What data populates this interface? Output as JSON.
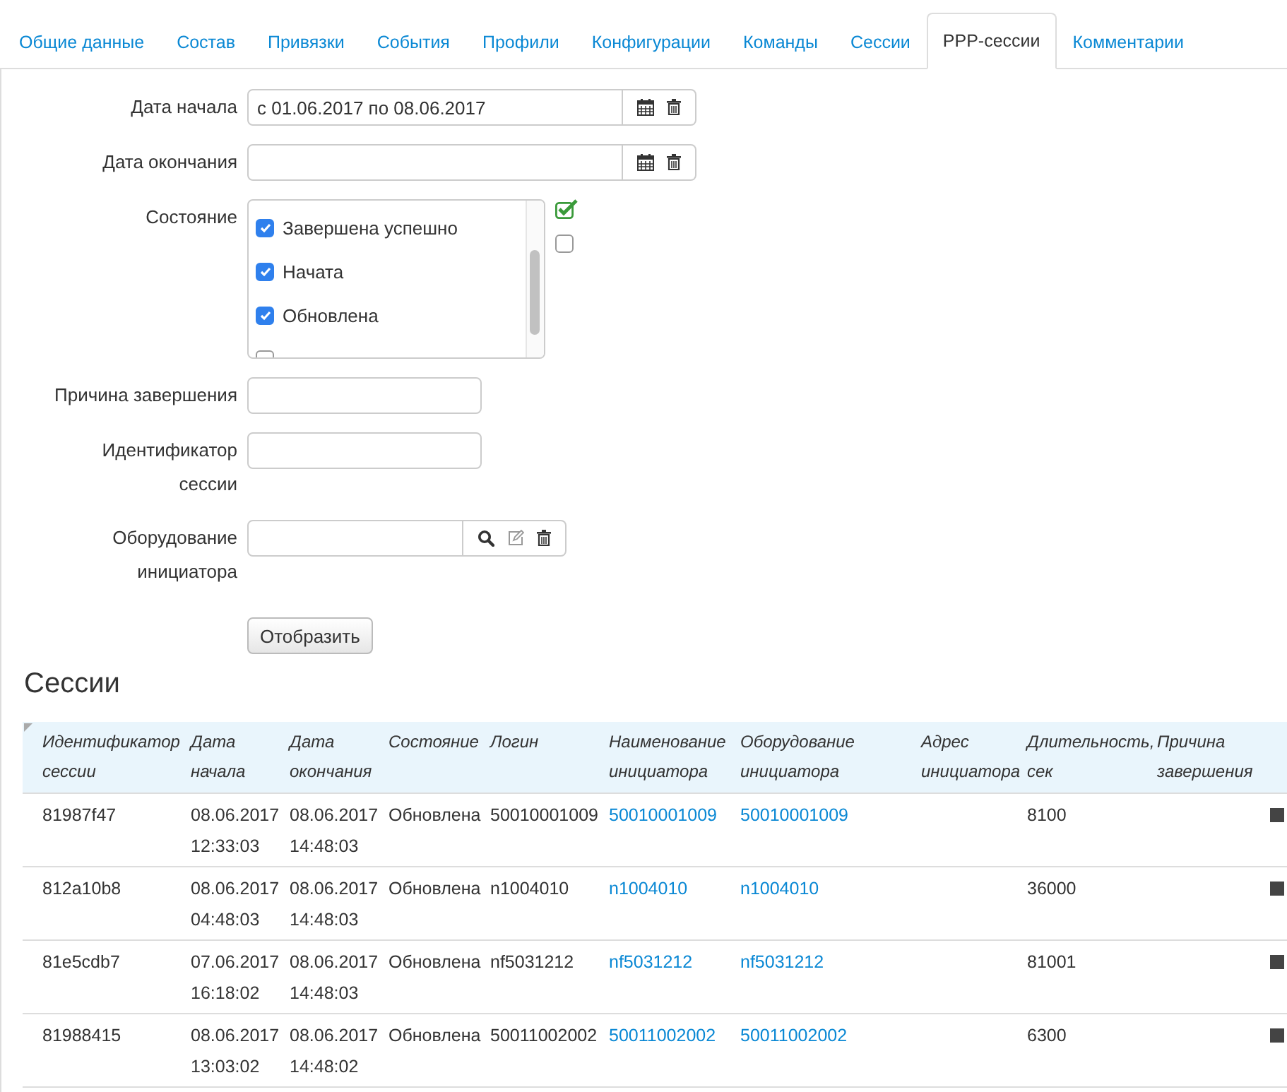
{
  "tabs": [
    {
      "label": "Общие данные",
      "selected": false
    },
    {
      "label": "Состав",
      "selected": false
    },
    {
      "label": "Привязки",
      "selected": false
    },
    {
      "label": "События",
      "selected": false
    },
    {
      "label": "Профили",
      "selected": false
    },
    {
      "label": "Конфигурации",
      "selected": false
    },
    {
      "label": "Команды",
      "selected": false
    },
    {
      "label": "Сессии",
      "selected": false
    },
    {
      "label": "PPP-сессии",
      "selected": true
    },
    {
      "label": "Комментарии",
      "selected": false
    }
  ],
  "filters": [
    {
      "kind": "date",
      "label": "Дата начала",
      "value": "с 01.06.2017 по 08.06.2017"
    },
    {
      "kind": "date",
      "label": "Дата окончания"
    },
    {
      "kind": "checklist",
      "label": "Состояние",
      "options": [
        {
          "label": "Завершена успешно",
          "checked": true
        },
        {
          "label": "Начата",
          "checked": true
        },
        {
          "label": "Обновлена",
          "checked": true
        },
        {
          "checked": false
        }
      ]
    },
    {
      "kind": "text",
      "label": "Причина завершения"
    },
    {
      "kind": "text",
      "label": "Идентификатор сессии"
    },
    {
      "kind": "lookup",
      "label": "Оборудование инициатора"
    }
  ],
  "submit_button": "Отобразить",
  "table": {
    "title": "Сессии",
    "columns": [
      "Идентификатор сессии",
      "Дата начала",
      "Дата окончания",
      "Состояние",
      "Логин",
      "Наименование инициатора",
      "Оборудование инициатора",
      "Адрес инициатора",
      "Длительность, сек",
      "Причина завершения"
    ],
    "rows": [
      {
        "id": "81987f47",
        "start": [
          "08.06.2017",
          "12:33:03"
        ],
        "end": [
          "08.06.2017",
          "14:48:03"
        ],
        "state": "Обновлена",
        "login": "50010001009",
        "initiator": "50010001009",
        "equipment": "50010001009",
        "address": "",
        "duration": "8100",
        "reason": ""
      },
      {
        "id": "812a10b8",
        "start": [
          "08.06.2017",
          "04:48:03"
        ],
        "end": [
          "08.06.2017",
          "14:48:03"
        ],
        "state": "Обновлена",
        "login": "n1004010",
        "initiator": "n1004010",
        "equipment": "n1004010",
        "address": "",
        "duration": "36000",
        "reason": ""
      },
      {
        "id": "81e5cdb7",
        "start": [
          "07.06.2017",
          "16:18:02"
        ],
        "end": [
          "08.06.2017",
          "14:48:03"
        ],
        "state": "Обновлена",
        "login": "nf5031212",
        "initiator": "nf5031212",
        "equipment": "nf5031212",
        "address": "",
        "duration": "81001",
        "reason": ""
      },
      {
        "id": "81988415",
        "start": [
          "08.06.2017",
          "13:03:02"
        ],
        "end": [
          "08.06.2017",
          "14:48:02"
        ],
        "state": "Обновлена",
        "login": "50011002002",
        "initiator": "50011002002",
        "equipment": "50011002002",
        "address": "",
        "duration": "6300",
        "reason": ""
      }
    ]
  }
}
